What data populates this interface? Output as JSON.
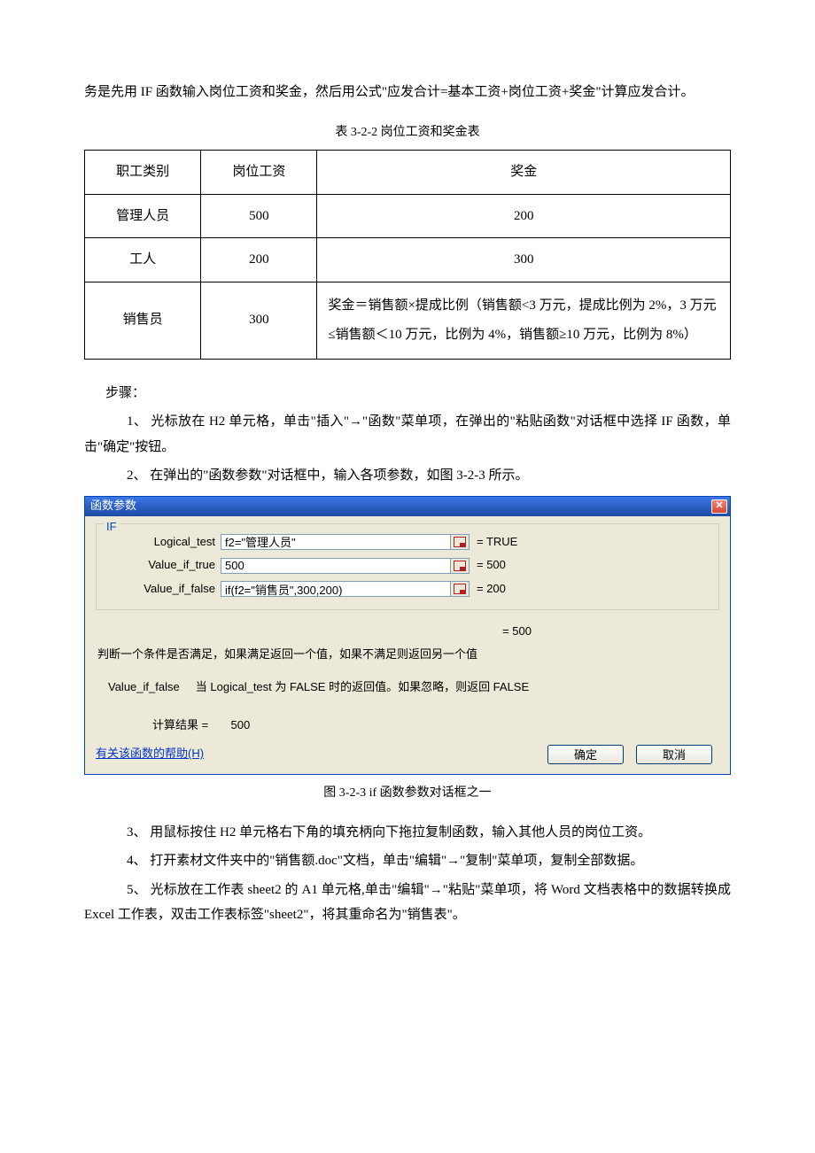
{
  "intro": "务是先用 IF 函数输入岗位工资和奖金，然后用公式\"应发合计=基本工资+岗位工资+奖金\"计算应发合计。",
  "table_caption": "表 3-2-2 岗位工资和奖金表",
  "table": {
    "headers": [
      "职工类别",
      "岗位工资",
      "奖金"
    ],
    "rows": [
      {
        "c0": "管理人员",
        "c1": "500",
        "c2": "200"
      },
      {
        "c0": "工人",
        "c1": "200",
        "c2": "300"
      },
      {
        "c0": "销售员",
        "c1": "300",
        "c2": "奖金＝销售额×提成比例（销售额<3 万元，提成比例为 2%，3 万元≤销售额＜10 万元，比例为 4%，销售额≥10 万元，比例为 8%）"
      }
    ]
  },
  "steps_label": "步骤：",
  "steps": {
    "s1": "1、 光标放在 H2 单元格，单击\"插入\"→\"函数\"菜单项，在弹出的\"粘贴函数\"对话框中选择 IF 函数，单击\"确定\"按钮。",
    "s2": "2、 在弹出的\"函数参数\"对话框中，输入各项参数，如图 3-2-3 所示。",
    "s3": "3、 用鼠标按住 H2 单元格右下角的填充柄向下拖拉复制函数，输入其他人员的岗位工资。",
    "s4": "4、 打开素材文件夹中的\"销售额.doc\"文档，单击\"编辑\"→\"复制\"菜单项，复制全部数据。",
    "s5": "5、 光标放在工作表 sheet2 的 A1 单元格,单击\"编辑\"→\"粘贴\"菜单项，将 Word 文档表格中的数据转换成 Excel 工作表，双击工作表标签\"sheet2\"，将其重命名为\"销售表\"。"
  },
  "dialog": {
    "title": "函数参数",
    "legend": "IF",
    "params": {
      "p1": {
        "label": "Logical_test",
        "value": "f2=\"管理人员\"",
        "result": "= TRUE"
      },
      "p2": {
        "label": "Value_if_true",
        "value": "500",
        "result": "= 500"
      },
      "p3": {
        "label": "Value_if_false",
        "value": "if(f2=\"销售员\",300,200)",
        "result": "= 200"
      }
    },
    "overall_result": "= 500",
    "desc1": "判断一个条件是否满足，如果满足返回一个值，如果不满足则返回另一个值",
    "desc2_label": "Value_if_false",
    "desc2_text": "当 Logical_test 为 FALSE 时的返回值。如果忽略，则返回 FALSE",
    "calc_label": "计算结果 =",
    "calc_value": "500",
    "help_link": "有关该函数的帮助(H)",
    "ok": "确定",
    "cancel": "取消"
  },
  "fig_caption": "图 3-2-3  if 函数参数对话框之一"
}
